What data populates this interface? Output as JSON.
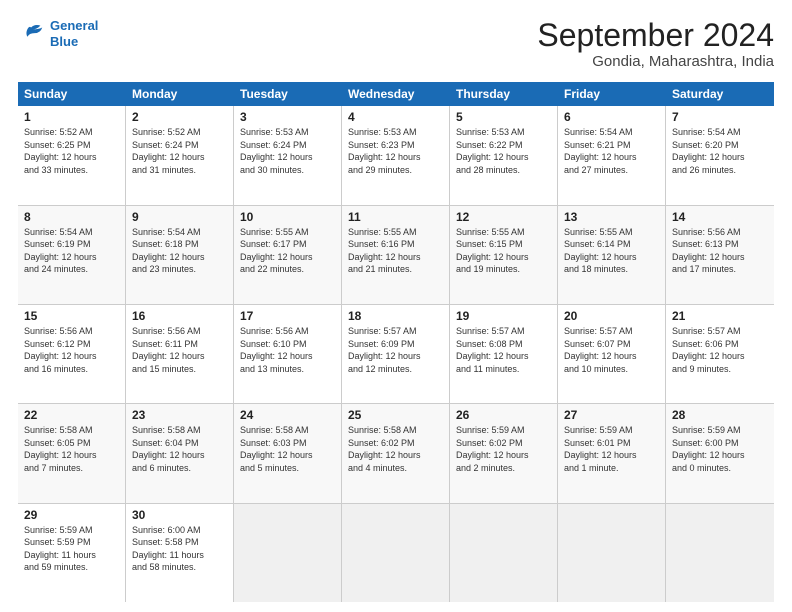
{
  "header": {
    "logo_line1": "General",
    "logo_line2": "Blue",
    "month": "September 2024",
    "location": "Gondia, Maharashtra, India"
  },
  "weekdays": [
    "Sunday",
    "Monday",
    "Tuesday",
    "Wednesday",
    "Thursday",
    "Friday",
    "Saturday"
  ],
  "rows": [
    [
      {
        "day": "1",
        "lines": [
          "Sunrise: 5:52 AM",
          "Sunset: 6:25 PM",
          "Daylight: 12 hours",
          "and 33 minutes."
        ]
      },
      {
        "day": "2",
        "lines": [
          "Sunrise: 5:52 AM",
          "Sunset: 6:24 PM",
          "Daylight: 12 hours",
          "and 31 minutes."
        ]
      },
      {
        "day": "3",
        "lines": [
          "Sunrise: 5:53 AM",
          "Sunset: 6:24 PM",
          "Daylight: 12 hours",
          "and 30 minutes."
        ]
      },
      {
        "day": "4",
        "lines": [
          "Sunrise: 5:53 AM",
          "Sunset: 6:23 PM",
          "Daylight: 12 hours",
          "and 29 minutes."
        ]
      },
      {
        "day": "5",
        "lines": [
          "Sunrise: 5:53 AM",
          "Sunset: 6:22 PM",
          "Daylight: 12 hours",
          "and 28 minutes."
        ]
      },
      {
        "day": "6",
        "lines": [
          "Sunrise: 5:54 AM",
          "Sunset: 6:21 PM",
          "Daylight: 12 hours",
          "and 27 minutes."
        ]
      },
      {
        "day": "7",
        "lines": [
          "Sunrise: 5:54 AM",
          "Sunset: 6:20 PM",
          "Daylight: 12 hours",
          "and 26 minutes."
        ]
      }
    ],
    [
      {
        "day": "8",
        "lines": [
          "Sunrise: 5:54 AM",
          "Sunset: 6:19 PM",
          "Daylight: 12 hours",
          "and 24 minutes."
        ]
      },
      {
        "day": "9",
        "lines": [
          "Sunrise: 5:54 AM",
          "Sunset: 6:18 PM",
          "Daylight: 12 hours",
          "and 23 minutes."
        ]
      },
      {
        "day": "10",
        "lines": [
          "Sunrise: 5:55 AM",
          "Sunset: 6:17 PM",
          "Daylight: 12 hours",
          "and 22 minutes."
        ]
      },
      {
        "day": "11",
        "lines": [
          "Sunrise: 5:55 AM",
          "Sunset: 6:16 PM",
          "Daylight: 12 hours",
          "and 21 minutes."
        ]
      },
      {
        "day": "12",
        "lines": [
          "Sunrise: 5:55 AM",
          "Sunset: 6:15 PM",
          "Daylight: 12 hours",
          "and 19 minutes."
        ]
      },
      {
        "day": "13",
        "lines": [
          "Sunrise: 5:55 AM",
          "Sunset: 6:14 PM",
          "Daylight: 12 hours",
          "and 18 minutes."
        ]
      },
      {
        "day": "14",
        "lines": [
          "Sunrise: 5:56 AM",
          "Sunset: 6:13 PM",
          "Daylight: 12 hours",
          "and 17 minutes."
        ]
      }
    ],
    [
      {
        "day": "15",
        "lines": [
          "Sunrise: 5:56 AM",
          "Sunset: 6:12 PM",
          "Daylight: 12 hours",
          "and 16 minutes."
        ]
      },
      {
        "day": "16",
        "lines": [
          "Sunrise: 5:56 AM",
          "Sunset: 6:11 PM",
          "Daylight: 12 hours",
          "and 15 minutes."
        ]
      },
      {
        "day": "17",
        "lines": [
          "Sunrise: 5:56 AM",
          "Sunset: 6:10 PM",
          "Daylight: 12 hours",
          "and 13 minutes."
        ]
      },
      {
        "day": "18",
        "lines": [
          "Sunrise: 5:57 AM",
          "Sunset: 6:09 PM",
          "Daylight: 12 hours",
          "and 12 minutes."
        ]
      },
      {
        "day": "19",
        "lines": [
          "Sunrise: 5:57 AM",
          "Sunset: 6:08 PM",
          "Daylight: 12 hours",
          "and 11 minutes."
        ]
      },
      {
        "day": "20",
        "lines": [
          "Sunrise: 5:57 AM",
          "Sunset: 6:07 PM",
          "Daylight: 12 hours",
          "and 10 minutes."
        ]
      },
      {
        "day": "21",
        "lines": [
          "Sunrise: 5:57 AM",
          "Sunset: 6:06 PM",
          "Daylight: 12 hours",
          "and 9 minutes."
        ]
      }
    ],
    [
      {
        "day": "22",
        "lines": [
          "Sunrise: 5:58 AM",
          "Sunset: 6:05 PM",
          "Daylight: 12 hours",
          "and 7 minutes."
        ]
      },
      {
        "day": "23",
        "lines": [
          "Sunrise: 5:58 AM",
          "Sunset: 6:04 PM",
          "Daylight: 12 hours",
          "and 6 minutes."
        ]
      },
      {
        "day": "24",
        "lines": [
          "Sunrise: 5:58 AM",
          "Sunset: 6:03 PM",
          "Daylight: 12 hours",
          "and 5 minutes."
        ]
      },
      {
        "day": "25",
        "lines": [
          "Sunrise: 5:58 AM",
          "Sunset: 6:02 PM",
          "Daylight: 12 hours",
          "and 4 minutes."
        ]
      },
      {
        "day": "26",
        "lines": [
          "Sunrise: 5:59 AM",
          "Sunset: 6:02 PM",
          "Daylight: 12 hours",
          "and 2 minutes."
        ]
      },
      {
        "day": "27",
        "lines": [
          "Sunrise: 5:59 AM",
          "Sunset: 6:01 PM",
          "Daylight: 12 hours",
          "and 1 minute."
        ]
      },
      {
        "day": "28",
        "lines": [
          "Sunrise: 5:59 AM",
          "Sunset: 6:00 PM",
          "Daylight: 12 hours",
          "and 0 minutes."
        ]
      }
    ],
    [
      {
        "day": "29",
        "lines": [
          "Sunrise: 5:59 AM",
          "Sunset: 5:59 PM",
          "Daylight: 11 hours",
          "and 59 minutes."
        ]
      },
      {
        "day": "30",
        "lines": [
          "Sunrise: 6:00 AM",
          "Sunset: 5:58 PM",
          "Daylight: 11 hours",
          "and 58 minutes."
        ]
      },
      {
        "day": "",
        "lines": []
      },
      {
        "day": "",
        "lines": []
      },
      {
        "day": "",
        "lines": []
      },
      {
        "day": "",
        "lines": []
      },
      {
        "day": "",
        "lines": []
      }
    ]
  ]
}
